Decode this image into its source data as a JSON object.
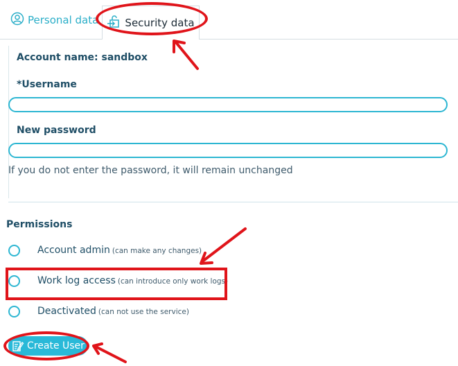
{
  "tabs": {
    "personal_label": "Personal data",
    "security_label": "Security data",
    "personal_icon": "user-circle-icon",
    "security_icon": "lock-login-icon"
  },
  "form": {
    "account_name": "Account name: sandbox",
    "username_required_mark": "*",
    "username_label": "Username",
    "username_value": "",
    "password_label": "New password",
    "password_value": "",
    "password_hint": "If you do not enter the password, it will remain unchanged"
  },
  "permissions": {
    "title": "Permissions",
    "options": [
      {
        "label": "Account admin",
        "note": "(can make any changes)",
        "selected": false
      },
      {
        "label": "Work log access",
        "note": "(can introduce only work logs)",
        "selected": false
      },
      {
        "label": "Deactivated",
        "note": "(can not use the service)",
        "selected": false
      }
    ]
  },
  "actions": {
    "create_user_label": "Create User",
    "create_user_icon": "edit-note-icon"
  },
  "colors": {
    "accent": "#2cb6d2",
    "text": "#1f4e66",
    "annotation": "#e0141a"
  }
}
